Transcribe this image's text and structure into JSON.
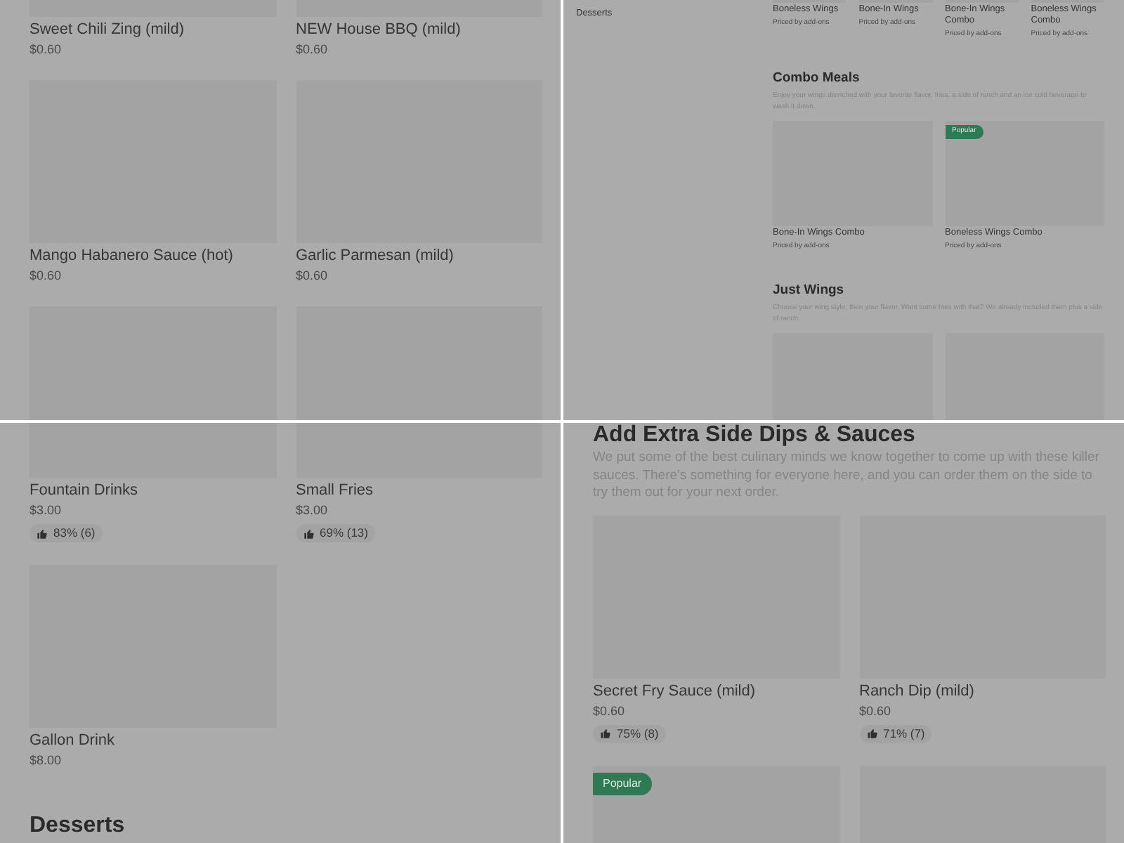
{
  "panels": [
    {
      "kind": "large",
      "sections": [
        {
          "items": [
            {
              "kind": "card",
              "name": "Sweet Chili Zing (mild)",
              "price": "$0.60"
            },
            {
              "kind": "card",
              "name": "NEW House BBQ (mild)",
              "price": "$0.60"
            },
            {
              "kind": "card",
              "name": "Mango Habanero Sauce (hot)",
              "price": "$0.60"
            },
            {
              "kind": "card",
              "name": "Garlic Parmesan (mild)",
              "price": "$0.60"
            },
            {
              "kind": "image"
            },
            {
              "kind": "image"
            }
          ]
        }
      ]
    },
    {
      "kind": "small",
      "sidebar": [
        "Desserts"
      ],
      "sections": [
        {
          "kind": "strip",
          "items": [
            {
              "kind": "card",
              "name": "Boneless Wings",
              "price": "Priced by add-ons"
            },
            {
              "kind": "card",
              "name": "Bone-In Wings",
              "price": "Priced by add-ons"
            },
            {
              "kind": "card",
              "name": "Bone-In Wings Combo",
              "price": "Priced by add-ons"
            },
            {
              "kind": "card",
              "name": "Boneless Wings Combo",
              "price": "Priced by add-ons"
            }
          ]
        },
        {
          "kind": "grid",
          "title": "Combo Meals",
          "description": "Enjoy your wings drenched with your favorite flavor, fries, a side of ranch and an ice cold beverage to wash it down.",
          "items": [
            {
              "kind": "card",
              "name": "Bone-In Wings Combo",
              "price": "Priced by add-ons"
            },
            {
              "kind": "card",
              "name": "Boneless Wings Combo",
              "price": "Priced by add-ons",
              "badge": "Popular"
            }
          ]
        },
        {
          "kind": "grid",
          "title": "Just Wings",
          "description": "Choose your wing style, then your flavor. Want some fries with that? We already included them plus a side of ranch.",
          "items": [
            {
              "kind": "image"
            },
            {
              "kind": "image"
            }
          ]
        }
      ]
    },
    {
      "kind": "large",
      "sections": [
        {
          "items": [
            {
              "kind": "card",
              "name": "Fountain Drinks",
              "price": "$3.00",
              "rating": "83% (6)"
            },
            {
              "kind": "card",
              "name": "Small Fries",
              "price": "$3.00",
              "rating": "69% (13)"
            },
            {
              "kind": "card",
              "name": "Gallon Drink",
              "price": "$8.00"
            }
          ]
        },
        {
          "title": "Desserts"
        }
      ]
    },
    {
      "kind": "large",
      "sections": [
        {
          "title": "Add Extra Side Dips & Sauces",
          "description": "We put some of the best culinary minds we know together to come up with these killer sauces. There's something for everyone here, and you can order them on the side to try them out for your next order.",
          "items": [
            {
              "kind": "card",
              "name": "Secret Fry Sauce (mild)",
              "price": "$0.60",
              "rating": "75% (8)"
            },
            {
              "kind": "card",
              "name": "Ranch Dip (mild)",
              "price": "$0.60",
              "rating": "71% (7)"
            },
            {
              "kind": "image",
              "badge": "Popular"
            },
            {
              "kind": "image"
            }
          ]
        }
      ]
    }
  ]
}
